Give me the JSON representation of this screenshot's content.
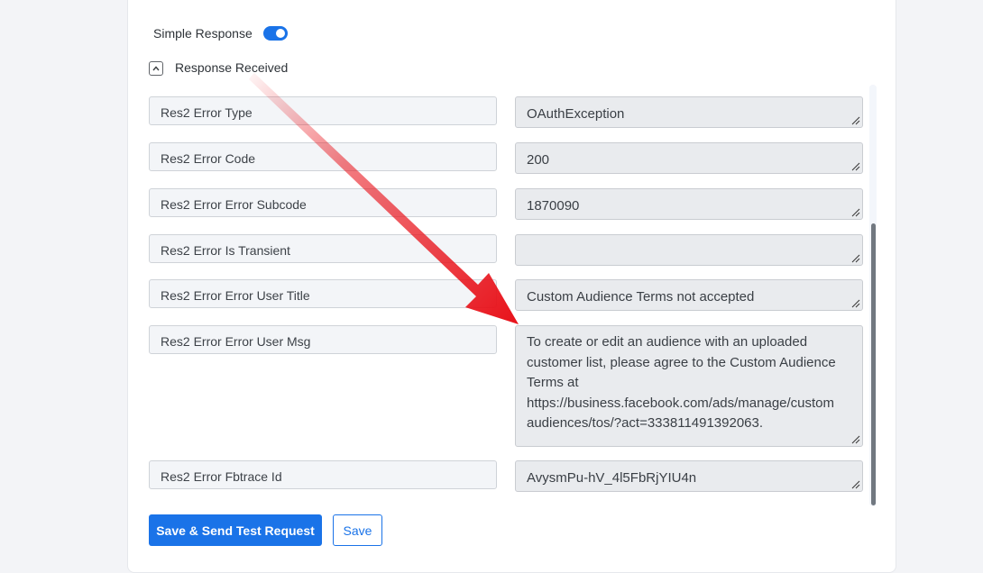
{
  "simple_response": {
    "label": "Simple Response",
    "enabled": true
  },
  "response_section": {
    "label": "Response Received",
    "expanded": true
  },
  "fields": [
    {
      "key": "Res2 Error Type",
      "value": "OAuthException"
    },
    {
      "key": "Res2 Error Code",
      "value": "200"
    },
    {
      "key": "Res2 Error Error Subcode",
      "value": "1870090"
    },
    {
      "key": "Res2 Error Is Transient",
      "value": ""
    },
    {
      "key": "Res2 Error Error User Title",
      "value": "Custom Audience Terms not accepted"
    },
    {
      "key": "Res2 Error Error User Msg",
      "value_lines": [
        "To create or edit an audience with an uploaded",
        "customer list, please agree to the Custom Audience",
        "Terms at",
        "https://business.facebook.com/ads/manage/custom",
        "audiences/tos/?act=333811491392063."
      ]
    },
    {
      "key": "Res2 Error Fbtrace Id",
      "value": "AvysmPu-hV_4l5FbRjYIU4n"
    }
  ],
  "buttons": {
    "save_send": "Save & Send Test Request",
    "save": "Save"
  },
  "colors": {
    "accent": "#1a73e8",
    "annotation_arrow": "#e8121a"
  },
  "icons": {
    "collapse": "chevron-up-icon",
    "resize": "resize-grip-icon",
    "annotation": "red-arrow-annotation"
  }
}
